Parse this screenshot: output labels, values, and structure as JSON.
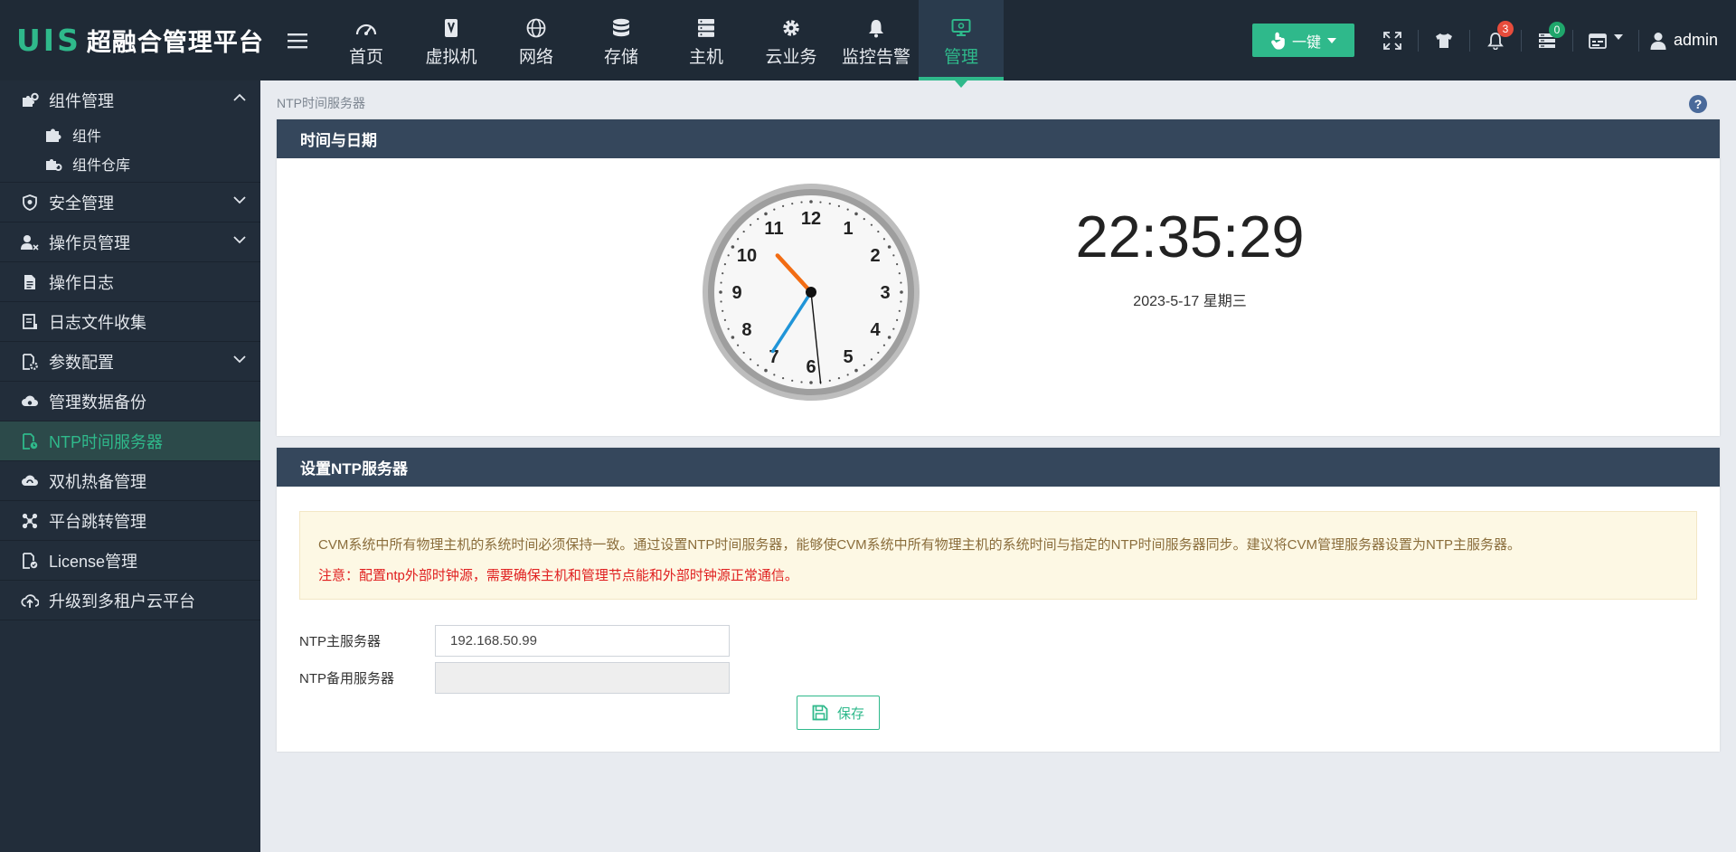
{
  "brand": {
    "logo": "UIS",
    "title": "超融合管理平台"
  },
  "nav": [
    {
      "label": "首页",
      "icon": "dashboard-icon"
    },
    {
      "label": "虚拟机",
      "icon": "vm-icon"
    },
    {
      "label": "网络",
      "icon": "globe-icon"
    },
    {
      "label": "存储",
      "icon": "database-icon"
    },
    {
      "label": "主机",
      "icon": "server-icon"
    },
    {
      "label": "云业务",
      "icon": "gear-icon"
    },
    {
      "label": "监控告警",
      "icon": "bell-icon"
    },
    {
      "label": "管理",
      "icon": "monitor-icon",
      "active": true
    }
  ],
  "topright": {
    "onekey_label": "一键",
    "alarm_count": "3",
    "task_count": "0",
    "user": "admin"
  },
  "colors": {
    "accent": "#2fb98b",
    "topbar": "#1f2a36",
    "sidebar": "#222d3a",
    "panel_head": "#35475c"
  },
  "sidebar": {
    "group": {
      "label": "组件管理",
      "subitems": [
        "组件",
        "组件仓库"
      ]
    },
    "items": [
      {
        "label": "安全管理"
      },
      {
        "label": "操作员管理"
      },
      {
        "label": "操作日志"
      },
      {
        "label": "日志文件收集"
      },
      {
        "label": "参数配置"
      },
      {
        "label": "管理数据备份"
      },
      {
        "label": "NTP时间服务器"
      },
      {
        "label": "双机热备管理"
      },
      {
        "label": "平台跳转管理"
      },
      {
        "label": "License管理"
      },
      {
        "label": "升级到多租户云平台"
      }
    ]
  },
  "breadcrumb": "NTP时间服务器",
  "clock_panel": {
    "title": "时间与日期",
    "time": "22:35:29",
    "date": "2023-5-17  星期三",
    "clock": {
      "hours": 22,
      "minutes": 35,
      "seconds": 29
    }
  },
  "ntp_panel": {
    "title": "设置NTP服务器",
    "notice": "CVM系统中所有物理主机的系统时间必须保持一致。通过设置NTP时间服务器，能够使CVM系统中所有物理主机的系统时间与指定的NTP时间服务器同步。建议将CVM管理服务器设置为NTP主服务器。",
    "warning": "注意：配置ntp外部时钟源，需要确保主机和管理节点能和外部时钟源正常通信。",
    "primary_label": "NTP主服务器",
    "primary_value": "192.168.50.99",
    "backup_label": "NTP备用服务器",
    "backup_value": "",
    "save_label": "保存"
  }
}
